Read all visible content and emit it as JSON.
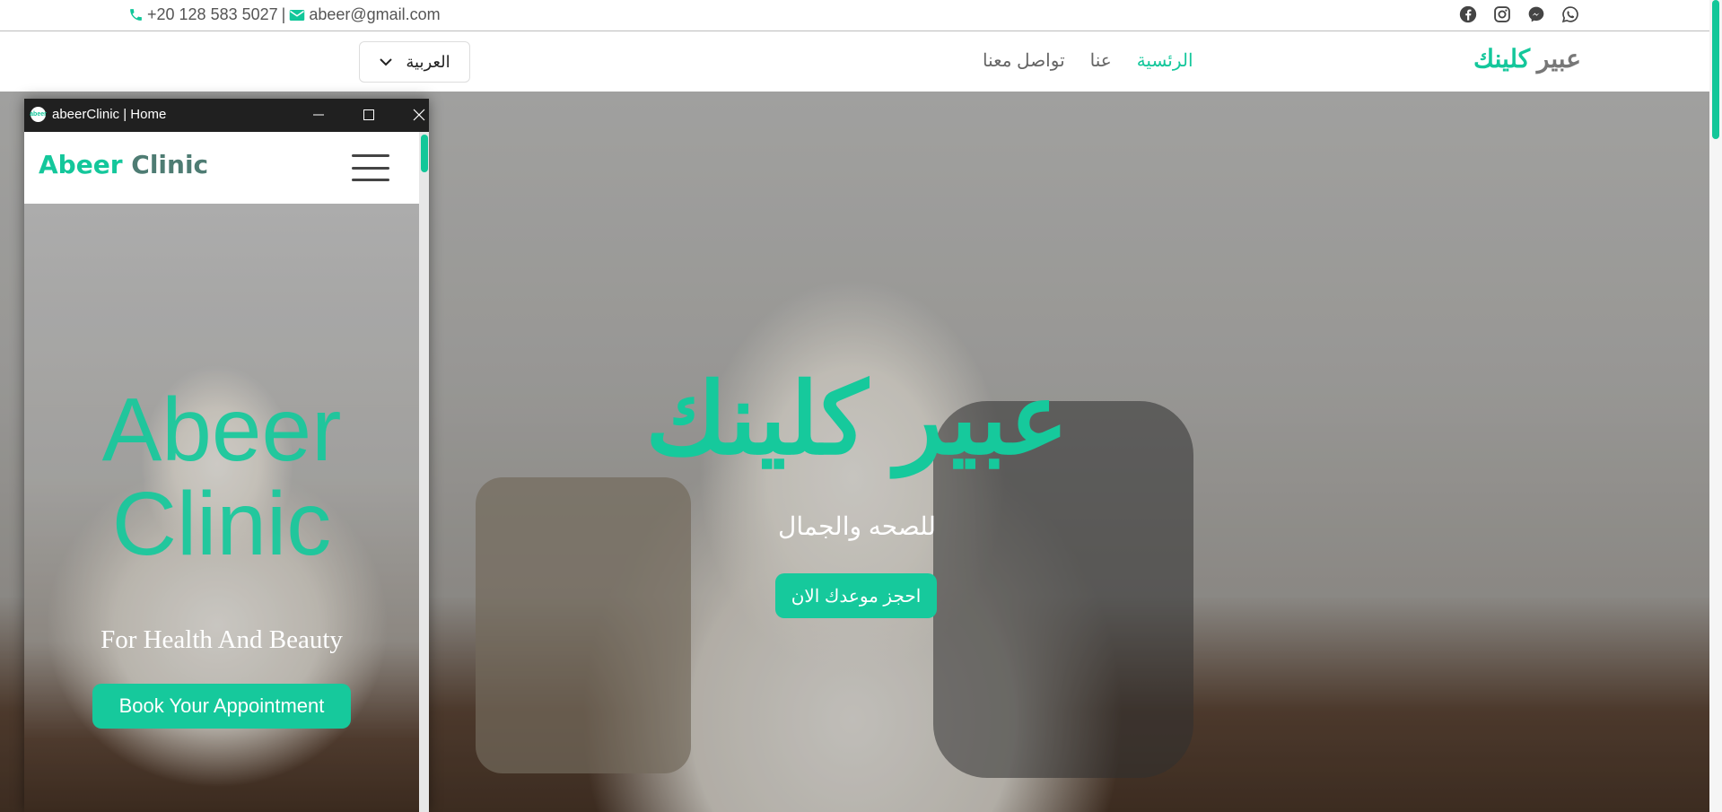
{
  "topbar": {
    "phone": "+20 128 583 5027",
    "separator": "|",
    "email": "abeer@gmail.com",
    "icons": [
      "phone-icon",
      "envelope-icon",
      "facebook-icon",
      "instagram-icon",
      "messenger-icon",
      "whatsapp-icon"
    ]
  },
  "nav": {
    "language_label": "العربية",
    "menu": [
      {
        "label": "الرئسية",
        "active": true
      },
      {
        "label": "عنا",
        "active": false
      },
      {
        "label": "تواصل معنا",
        "active": false
      }
    ],
    "brand_part1": "عبير",
    "brand_part2": "كلينك"
  },
  "hero": {
    "title": "عبير كلينك",
    "subtitle": "للصحه والجمال",
    "cta": "احجز موعدك الان"
  },
  "popup": {
    "window_title": "abeerClinic | Home",
    "logo_text": "abeer",
    "brand_part1": "Abeer",
    "brand_part2": "Clinic",
    "hero_title_line1": "Abeer",
    "hero_title_line2": "Clinic",
    "hero_subtitle": "For Health And Beauty",
    "cta": "Book Your Appointment"
  },
  "colors": {
    "accent": "#14c79b",
    "text_muted": "#666666",
    "title_bar": "#202020"
  }
}
